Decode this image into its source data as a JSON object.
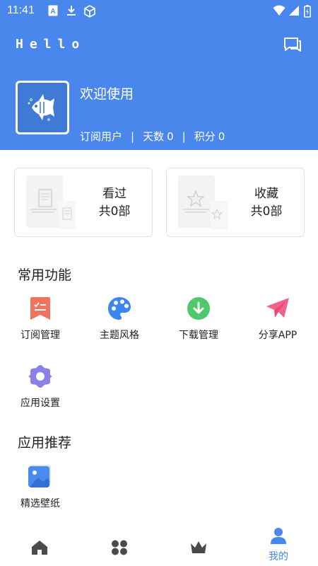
{
  "status_bar": {
    "time": "11:41"
  },
  "header": {
    "app_name": "Hello",
    "welcome": "欢迎使用",
    "user_type": "订阅用户",
    "days_label": "天数",
    "days_value": "0",
    "points_label": "积分",
    "points_value": "0"
  },
  "cards": [
    {
      "title": "看过",
      "count": "共0部"
    },
    {
      "title": "收藏",
      "count": "共0部"
    }
  ],
  "common_functions": {
    "title": "常用功能",
    "items": [
      {
        "label": "订阅管理",
        "icon": "subscription-icon",
        "color": "#f0735f"
      },
      {
        "label": "主题风格",
        "icon": "palette-icon",
        "color": "#3d86f0"
      },
      {
        "label": "下载管理",
        "icon": "download-icon",
        "color": "#4cc96a"
      },
      {
        "label": "分享APP",
        "icon": "send-icon",
        "color": "#f2608d"
      },
      {
        "label": "应用设置",
        "icon": "settings-icon",
        "color": "#8b80e8"
      }
    ]
  },
  "recommend": {
    "title": "应用推荐",
    "items": [
      {
        "label": "精选壁纸",
        "icon": "wallpaper-icon"
      }
    ]
  },
  "bottom_nav": {
    "items": [
      {
        "icon": "home-icon"
      },
      {
        "icon": "apps-icon"
      },
      {
        "icon": "crown-icon"
      },
      {
        "icon": "user-icon",
        "label": "我的",
        "active": true
      }
    ],
    "active_color": "#4a87ec",
    "inactive_color": "#4a4a4a"
  },
  "colors": {
    "primary": "#4a87ec"
  }
}
